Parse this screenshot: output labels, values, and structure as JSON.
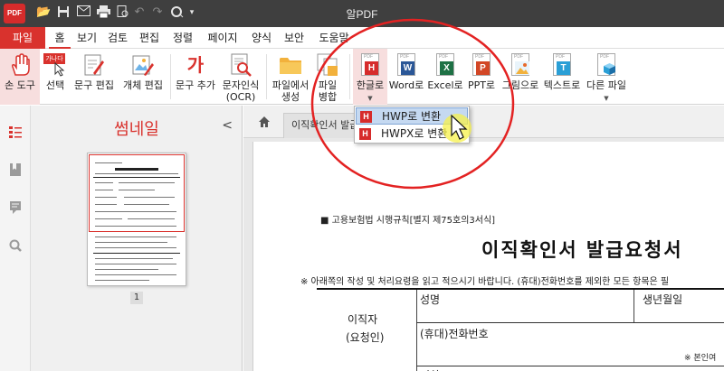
{
  "app": {
    "logo_text": "PDF",
    "title": "알PDF"
  },
  "menu": {
    "tabs": [
      "파일",
      "홈",
      "보기",
      "검토",
      "편집",
      "정렬",
      "페이지",
      "양식",
      "보안",
      "도움말"
    ]
  },
  "ribbon": {
    "hand_tool": "손 도구",
    "select": "선택",
    "select_badge": "가나다",
    "text_edit": "문구 편집",
    "object_edit": "개체 편집",
    "add_text": "문구 추가",
    "add_text_glyph": "가",
    "ocr_line1": "문자인식",
    "ocr_line2": "(OCR)",
    "from_file_line1": "파일에서",
    "from_file_line2": "생성",
    "merge_line1": "파일",
    "merge_line2": "병합",
    "to_hangul": "한글로",
    "to_word": "Word로",
    "to_excel": "Excel로",
    "to_ppt": "PPT로",
    "to_image": "그림으로",
    "to_text": "텍스트로",
    "other_file": "다른 파일",
    "letters": {
      "hwp": "H",
      "word": "W",
      "excel": "X",
      "ppt": "P",
      "text": "T",
      "pdf": "PDF"
    }
  },
  "dropdown": {
    "items": [
      {
        "label": "HWP로 변환",
        "highlighted": true
      },
      {
        "label": "HWPX로 변환",
        "highlighted": false
      }
    ]
  },
  "thumbnails": {
    "title": "썸네일",
    "collapse_glyph": "<",
    "page_number": "1"
  },
  "document": {
    "tab_label": "이직확인서 발급",
    "law_ref": "■ 고용보험법 시행규칙[별지 제75호의3서식]",
    "title": "이직확인서 발급요청서",
    "note": "※ 아래쪽의 작성 및 처리요령을 읽고 적으시기 바랍니다. (휴대)전화번호를 제외한 모든 항목은 필",
    "row_label_1": "이직자",
    "row_label_2": "(요청인)",
    "field_name": "성명",
    "field_birth": "생년월일",
    "field_phone": "(휴대)전화번호",
    "small_note": "※ 본인여",
    "partial_text": "여하"
  },
  "colors": {
    "accent": "#d9322d",
    "titlebar": "#3f3f3f",
    "highlight": "#c5d9f1",
    "hwp": "#d62b2b",
    "word": "#2b5797",
    "excel": "#1e7145",
    "ppt": "#d24726",
    "text": "#2a9fd6"
  }
}
